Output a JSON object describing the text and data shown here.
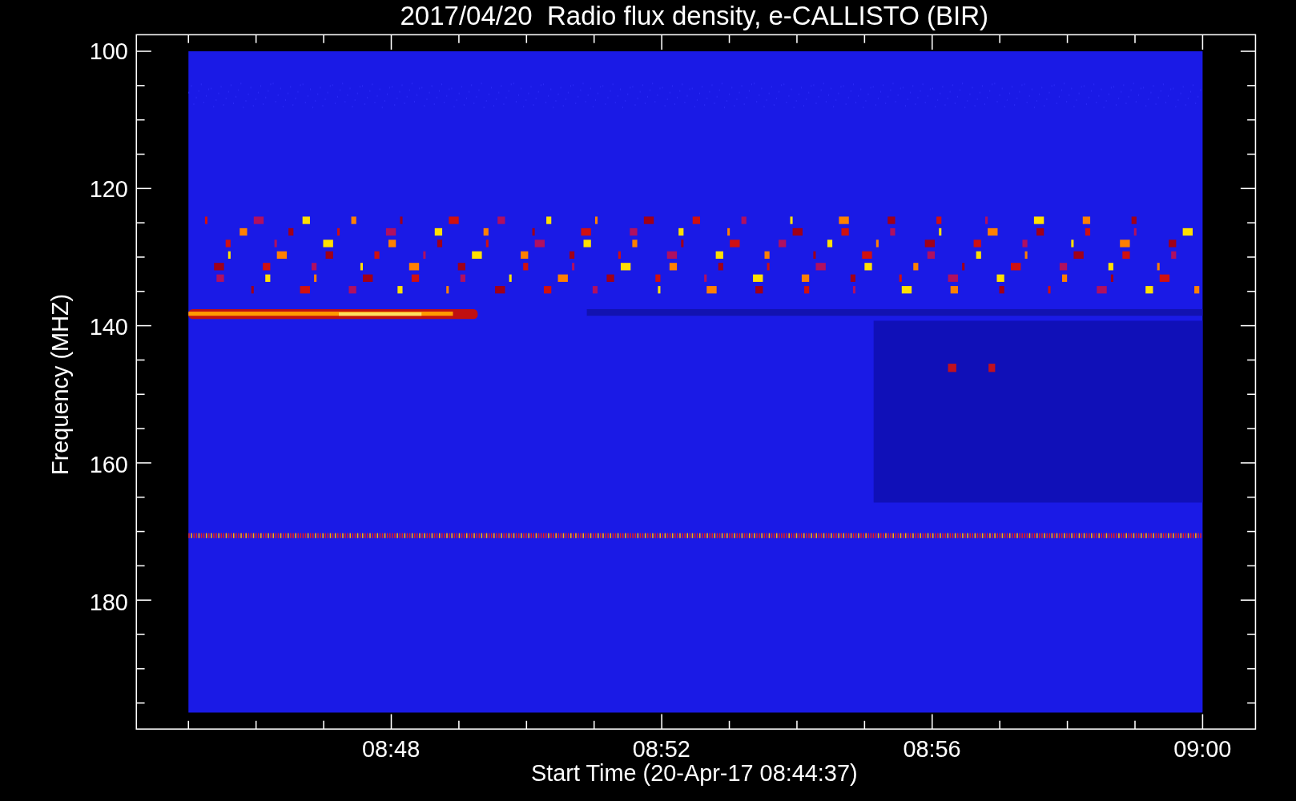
{
  "title": "2017/04/20  Radio flux density, e-CALLISTO (BIR)",
  "ylabel": "Frequency (MHZ)",
  "xlabel": "Start Time (20-Apr-17 08:44:37)",
  "yticks": [
    "100",
    "120",
    "140",
    "160",
    "180"
  ],
  "xticks": [
    "08:48",
    "08:52",
    "08:56",
    "09:00"
  ]
}
